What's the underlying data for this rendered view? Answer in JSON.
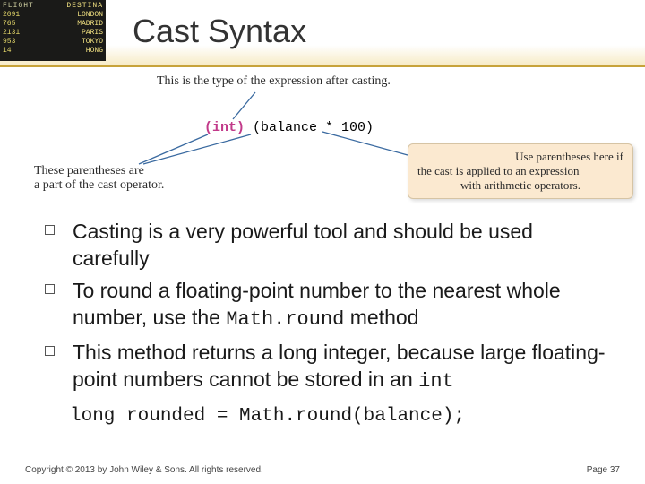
{
  "header": {
    "title": "Cast Syntax",
    "flight_board": {
      "hdr_left": "FLIGHT",
      "hdr_right": "DESTINA",
      "rows": [
        {
          "f": "2091",
          "d": "LONDON"
        },
        {
          "f": "765",
          "d": "MADRID"
        },
        {
          "f": "2131",
          "d": "PARIS"
        },
        {
          "f": "953",
          "d": "TOKYO"
        },
        {
          "f": "14",
          "d": "HONG"
        }
      ]
    }
  },
  "diagram": {
    "top_note": "This is the type of the expression after casting.",
    "code_int": "(int)",
    "code_rest": " (balance * 100)",
    "left_note_l1": "These parentheses are",
    "left_note_l2": "a part of the cast operator.",
    "balloon_l1": "Use parentheses here if",
    "balloon_l2": "the cast is applied to an expression",
    "balloon_l3": "with arithmetic operators."
  },
  "bullets": {
    "items": [
      {
        "text": "Casting is a very powerful tool and should be used carefully"
      },
      {
        "text_pre": "To round a floating-point number to the nearest whole number, use the ",
        "code": "Math.round",
        "text_post": " method"
      },
      {
        "text_pre": "This method returns a long integer, because large floating-point numbers cannot be stored in an ",
        "code": "int",
        "text_post": ""
      }
    ]
  },
  "code_line": "long rounded = Math.round(balance);",
  "footer": {
    "copyright": "Copyright © 2013 by John Wiley & Sons. All rights reserved.",
    "page": "Page 37"
  }
}
